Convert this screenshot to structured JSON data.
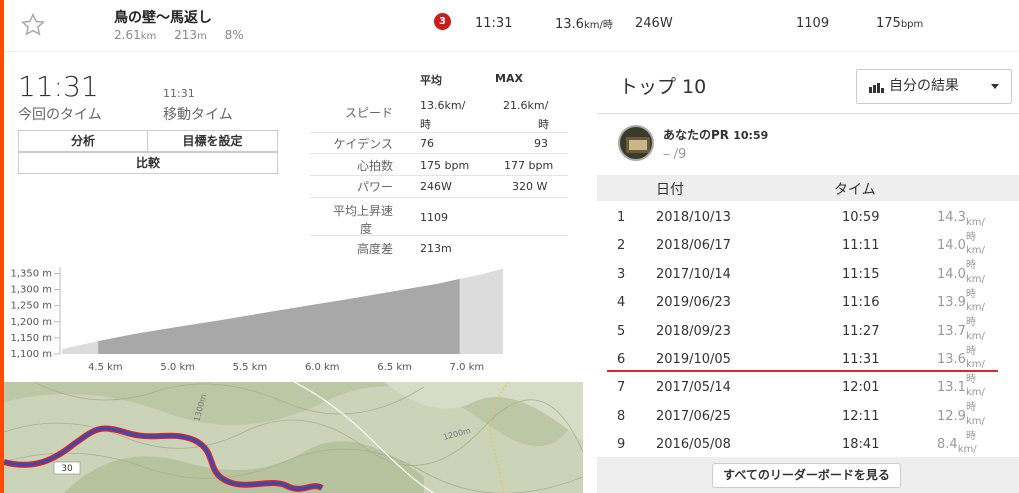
{
  "segment": {
    "name": "鳥の壁〜馬返し",
    "distance": "2.61",
    "distance_unit": "km",
    "elevation": "213",
    "elevation_unit": "m",
    "grade": "8%"
  },
  "effort_row": {
    "rank": "3",
    "time": "11:31",
    "speed": "13.6",
    "speed_unit": "km/時",
    "power": "246W",
    "vam": "1109",
    "heartrate": "175",
    "heartrate_unit": "bpm"
  },
  "summary": {
    "time": "11:31",
    "time_label": "今回のタイム",
    "moving_time": "11:31",
    "moving_label": "移動タイム",
    "btn_analysis": "分析",
    "btn_goal": "目標を設定",
    "btn_compare": "比較"
  },
  "stats": {
    "avg_header": "平均",
    "max_header": "MAX",
    "rows": [
      {
        "label": "スピード",
        "avg": "13.6km/",
        "avg2": "時",
        "max": "21.6km/",
        "max2": "時"
      },
      {
        "label": "ケイデンス",
        "avg": "76",
        "max": "93"
      },
      {
        "label": "心拍数",
        "avg": "175 bpm",
        "max": "177 bpm"
      },
      {
        "label": "パワー",
        "avg": "246W",
        "max": "320 W"
      },
      {
        "label": "平均上昇速",
        "label2": "度",
        "avg": "1109"
      },
      {
        "label": "高度差",
        "avg": "213m"
      }
    ]
  },
  "chart_data": {
    "type": "area",
    "xlabel": "",
    "ylabel": "",
    "x_ticks": [
      "4.5 km",
      "5.0 km",
      "5.5 km",
      "6.0 km",
      "6.5 km",
      "7.0 km"
    ],
    "y_ticks": [
      "1,350 m",
      "1,300 m",
      "1,250 m",
      "1,200 m",
      "1,150 m",
      "1,100 m"
    ],
    "xlim": [
      4.2,
      7.25
    ],
    "ylim": [
      1100,
      1370
    ],
    "segment_range": [
      4.45,
      6.95
    ],
    "x": [
      4.2,
      4.45,
      4.7,
      5.0,
      5.3,
      5.6,
      5.9,
      6.2,
      6.5,
      6.8,
      6.95,
      7.1,
      7.25
    ],
    "y": [
      1115,
      1140,
      1162,
      1184,
      1205,
      1228,
      1250,
      1272,
      1295,
      1318,
      1333,
      1347,
      1365
    ]
  },
  "map": {
    "road_label": "30",
    "contour_labels": [
      "1300m",
      "1200m"
    ]
  },
  "leaderboard": {
    "title": "トップ 10",
    "filter": "自分の結果",
    "pr_label": "あなたのPR",
    "pr_time": "10:59",
    "pr_rank": "– /9",
    "col_date": "日付",
    "col_time": "タイム",
    "speed_unit": "km/時",
    "rows": [
      {
        "rank": "1",
        "date": "2018/10/13",
        "time": "10:59",
        "speed": "14.3"
      },
      {
        "rank": "2",
        "date": "2018/06/17",
        "time": "11:11",
        "speed": "14.0"
      },
      {
        "rank": "3",
        "date": "2017/10/14",
        "time": "11:15",
        "speed": "14.0"
      },
      {
        "rank": "4",
        "date": "2019/06/23",
        "time": "11:16",
        "speed": "13.9"
      },
      {
        "rank": "5",
        "date": "2018/09/23",
        "time": "11:27",
        "speed": "13.7"
      },
      {
        "rank": "6",
        "date": "2019/10/05",
        "time": "11:31",
        "speed": "13.6"
      },
      {
        "rank": "7",
        "date": "2017/05/14",
        "time": "12:01",
        "speed": "13.1"
      },
      {
        "rank": "8",
        "date": "2017/06/25",
        "time": "12:11",
        "speed": "12.9"
      },
      {
        "rank": "9",
        "date": "2016/05/08",
        "time": "18:41",
        "speed": "8.4"
      }
    ],
    "see_all": "すべてのリーダーボードを見る"
  },
  "colors": {
    "accent": "#fc4c02",
    "highlight": "#e0262d",
    "route": "#2b4fbf"
  }
}
